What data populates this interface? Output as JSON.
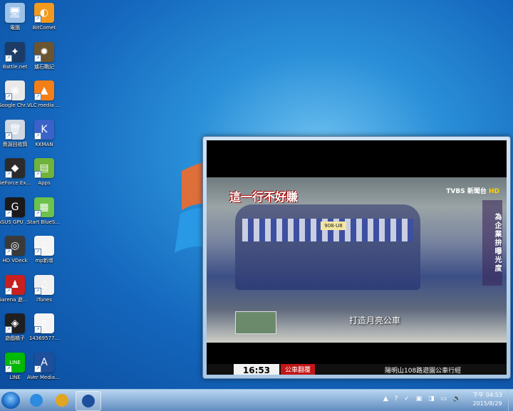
{
  "desktop_icons": [
    {
      "name": "computer",
      "label": "電腦",
      "color": "#9cc2e8",
      "glyph": "🖥"
    },
    {
      "name": "bitcomet",
      "label": "BitComet",
      "color": "#f39a1e",
      "glyph": "◐"
    },
    {
      "name": "battlenet",
      "label": "Battle.net",
      "color": "#1c3b66",
      "glyph": "✦"
    },
    {
      "name": "hearthstone",
      "label": "爐石戰記",
      "color": "#6b5530",
      "glyph": "✹"
    },
    {
      "name": "chrome",
      "label": "Google Chrome",
      "color": "#e9e9e9",
      "glyph": "◉"
    },
    {
      "name": "vlc",
      "label": "VLC media player",
      "color": "#f57f17",
      "glyph": "▲"
    },
    {
      "name": "recycle-bin",
      "label": "資源回收筒",
      "color": "#cfd8e3",
      "glyph": "🗑"
    },
    {
      "name": "kkman",
      "label": "KKMAN",
      "color": "#3a62c9",
      "glyph": "K"
    },
    {
      "name": "geforce",
      "label": "GeForce Experience",
      "color": "#2b2b2b",
      "glyph": "◆"
    },
    {
      "name": "apps",
      "label": "Apps",
      "color": "#6fb33a",
      "glyph": "▤"
    },
    {
      "name": "asus-gpu-tweak",
      "label": "ASUS GPU Tweak",
      "color": "#1a1a1a",
      "glyph": "G"
    },
    {
      "name": "bluestacks",
      "label": "Start BlueStacks",
      "color": "#6cc24a",
      "glyph": "▦"
    },
    {
      "name": "hd-vdeck",
      "label": "HD VDeck",
      "color": "#3a3a3a",
      "glyph": "◎"
    },
    {
      "name": "mp-file",
      "label": "mp新增",
      "color": "#f4f4f4",
      "glyph": "▯"
    },
    {
      "name": "garena",
      "label": "Garena 遊戲平台",
      "color": "#c8201f",
      "glyph": "♟"
    },
    {
      "name": "itunes",
      "label": "iTunes",
      "color": "#f0f0f0",
      "glyph": "♫"
    },
    {
      "name": "game-launcher",
      "label": "遊戲橘子",
      "color": "#1f1f1f",
      "glyph": "◈"
    },
    {
      "name": "file-1436",
      "label": "14369577...",
      "color": "#f4f4f4",
      "glyph": "▯"
    },
    {
      "name": "line",
      "label": "LINE",
      "color": "#00b900",
      "glyph": "LINE"
    },
    {
      "name": "aver-media",
      "label": "AVer MediaCen...",
      "color": "#1e4f9c",
      "glyph": "A"
    }
  ],
  "player": {
    "overlay_title": "這一行不好賺",
    "channel_prefix": "TVBS",
    "channel_name": "新聞台",
    "channel_hd": "HD",
    "side_vertical": "為企業拚曝光度",
    "caption": "打造月亮公車",
    "time": "16:53",
    "tag": "公車翻覆",
    "ticker": "陽明山108路遊園公車行經",
    "plate": "908-U8"
  },
  "taskbar": {
    "apps": [
      {
        "name": "internet-explorer",
        "color": "#2d8be0"
      },
      {
        "name": "chrome",
        "color": "#e0a521"
      },
      {
        "name": "aver-media",
        "color": "#1e4f9c"
      }
    ],
    "tray_icons": "▲ ? ✓ ▣ ◨ ▭ 🔊",
    "clock_time": "下午 04:53",
    "clock_date": "2015/8/29"
  }
}
